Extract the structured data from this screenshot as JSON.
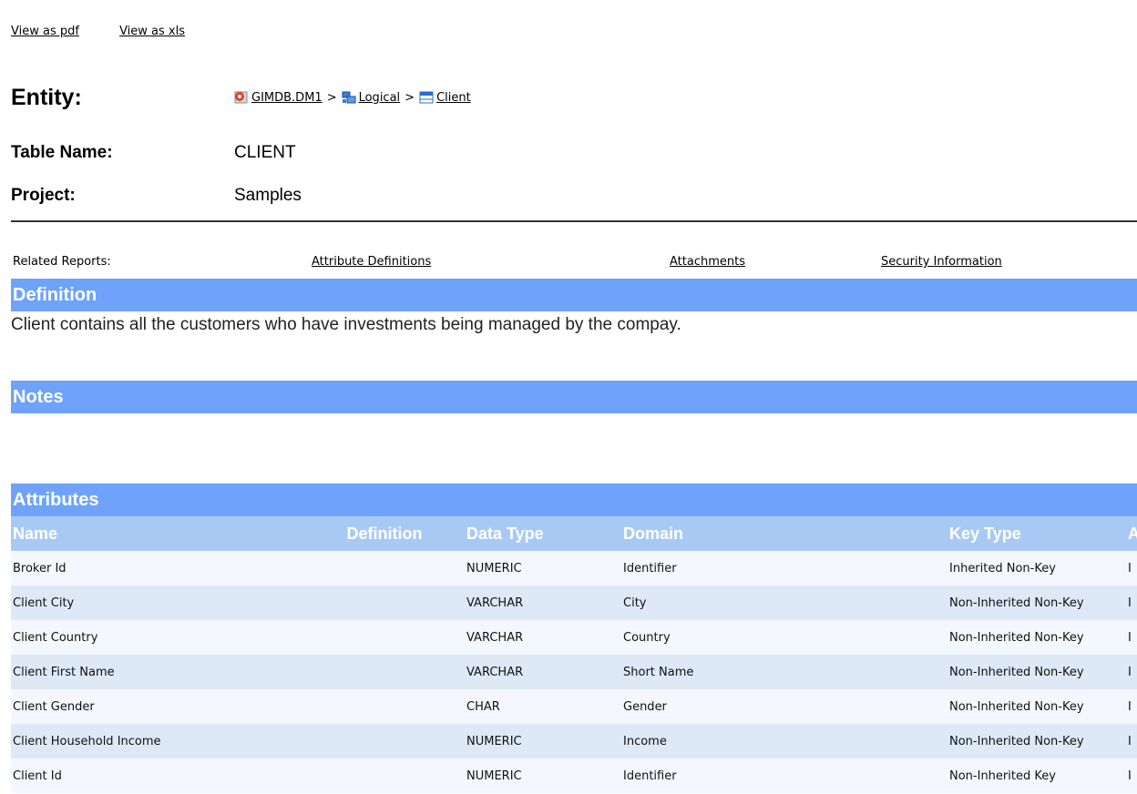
{
  "top_links": {
    "pdf": "View as pdf",
    "xls": "View as xls"
  },
  "entity": {
    "label": "Entity:",
    "breadcrumb": [
      {
        "label": "GIMDB.DM1",
        "icon": "model-icon"
      },
      {
        "label": "Logical",
        "icon": "logical-model-icon"
      },
      {
        "label": "Client",
        "icon": "entity-table-icon"
      }
    ],
    "separator": ">"
  },
  "table_name": {
    "label": "Table Name:",
    "value": "CLIENT"
  },
  "project": {
    "label": "Project:",
    "value": "Samples"
  },
  "related": {
    "label": "Related Reports:",
    "links": [
      "Attribute Definitions",
      "Attachments",
      "Security Information"
    ]
  },
  "definition": {
    "title": "Definition",
    "text": "Client contains all the customers who have investments being managed by the compay."
  },
  "notes": {
    "title": "Notes"
  },
  "attributes": {
    "title": "Attributes",
    "columns": [
      "Name",
      "Definition",
      "Data Type",
      "Domain",
      "Key Type",
      "A"
    ],
    "rows": [
      {
        "name": "Broker Id",
        "definition": "",
        "data_type": "NUMERIC",
        "domain": "Identifier",
        "key_type": "Inherited Non-Key",
        "extra": "I"
      },
      {
        "name": "Client City",
        "definition": "",
        "data_type": "VARCHAR",
        "domain": "City",
        "key_type": "Non-Inherited Non-Key",
        "extra": "I"
      },
      {
        "name": "Client Country",
        "definition": "",
        "data_type": "VARCHAR",
        "domain": "Country",
        "key_type": "Non-Inherited Non-Key",
        "extra": "I"
      },
      {
        "name": "Client First Name",
        "definition": "",
        "data_type": "VARCHAR",
        "domain": "Short Name",
        "key_type": "Non-Inherited Non-Key",
        "extra": "I"
      },
      {
        "name": "Client Gender",
        "definition": "",
        "data_type": "CHAR",
        "domain": "Gender",
        "key_type": "Non-Inherited Non-Key",
        "extra": "I"
      },
      {
        "name": "Client Household Income",
        "definition": "",
        "data_type": "NUMERIC",
        "domain": "Income",
        "key_type": "Non-Inherited Non-Key",
        "extra": "I"
      },
      {
        "name": "Client Id",
        "definition": "",
        "data_type": "NUMERIC",
        "domain": "Identifier",
        "key_type": "Non-Inherited Key",
        "extra": "I"
      }
    ]
  },
  "colors": {
    "section_bar": "#6ea3f9",
    "table_header": "#a9c9f5",
    "row_odd": "#f4f8fe",
    "row_even": "#dde9f6"
  }
}
